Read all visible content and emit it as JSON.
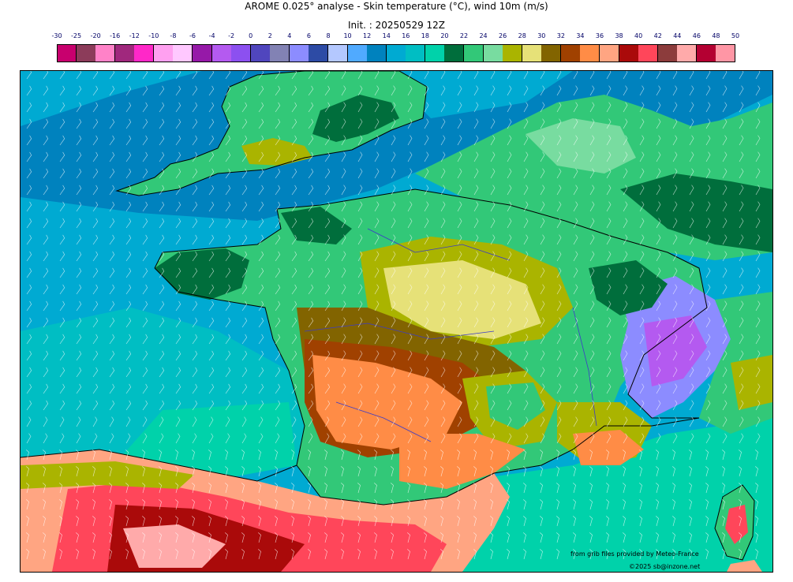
{
  "title_line1": "AROME 0.025° analyse - Skin temperature (°C), wind 10m (m/s)",
  "title_line2": "Init. : 20250529 12Z",
  "legend": {
    "ticks": [
      "-30",
      "-25",
      "-20",
      "-16",
      "-12",
      "-10",
      "-8",
      "-6",
      "-4",
      "-2",
      "0",
      "2",
      "4",
      "6",
      "8",
      "10",
      "12",
      "14",
      "16",
      "18",
      "20",
      "22",
      "24",
      "26",
      "28",
      "30",
      "32",
      "34",
      "36",
      "38",
      "40",
      "42",
      "44",
      "46",
      "48",
      "50"
    ],
    "colors": [
      "#c8006e",
      "#8c3c5a",
      "#ff82c8",
      "#a0287d",
      "#ff28c8",
      "#ffa0f0",
      "#ffc8ff",
      "#9619a8",
      "#b45af0",
      "#8c50f0",
      "#5046be",
      "#8282b4",
      "#8c8cff",
      "#2d4ba5",
      "#b4c8ff",
      "#50aaff",
      "#0082be",
      "#00aad2",
      "#00bec3",
      "#00d2aa",
      "#006e3c",
      "#32c878",
      "#78dca0",
      "#aab400",
      "#e6e178",
      "#826400",
      "#a04100",
      "#ff8c46",
      "#ffa582",
      "#aa0a0a",
      "#ff465a",
      "#8c3c3c",
      "#ffaaaa",
      "#b40032",
      "#ff96a5"
    ]
  },
  "map": {
    "colors": {
      "sea": "#00aad2",
      "sea_dark": "#0082be",
      "sea_warm": "#00bec3",
      "med": "#00d2aa",
      "land_cool": "#32c878",
      "land_pale": "#78dca0",
      "forest": "#006e3c",
      "olive": "#aab400",
      "yellow": "#e6e178",
      "brown": "#826400",
      "rust": "#a04100",
      "orange": "#ff8c46",
      "salmon": "#ffa582",
      "red": "#ff465a",
      "darkred": "#aa0a0a",
      "pink": "#ffaaaa",
      "alps": "#8c8cff",
      "alps_violet": "#b45af0",
      "coast": "#000000",
      "border": "#3c3cc8",
      "wind": "#ffffff"
    }
  },
  "credits": {
    "line1": "from grib files provided by Meteo-France",
    "line2": "©2025 sb@inzone.net"
  }
}
